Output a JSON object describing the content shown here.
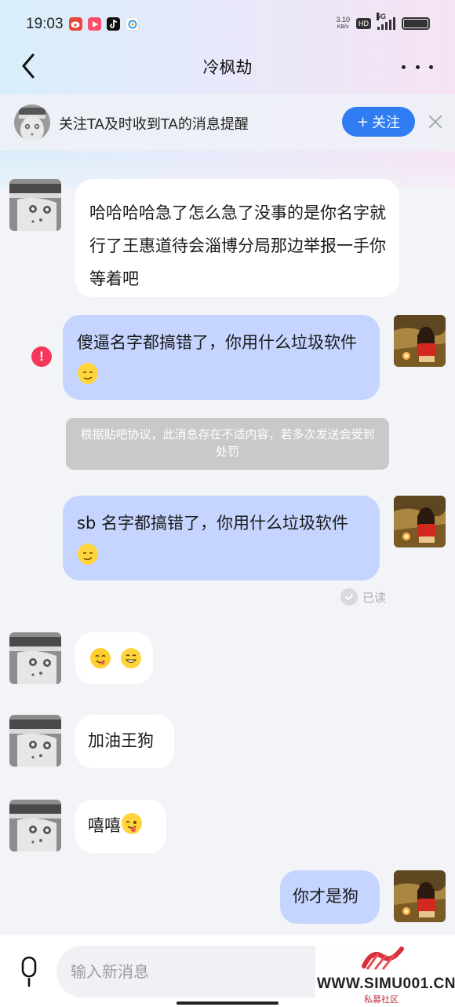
{
  "status_bar": {
    "time": "19:03",
    "net_speed_value": "3.10",
    "net_speed_unit": "KB/s",
    "hd_label": "HD",
    "signal_label": "5G"
  },
  "header": {
    "title": "冷枫劫",
    "back_icon": "chevron-left-icon",
    "more_icon": "more-dots-icon"
  },
  "follow_banner": {
    "text": "关注TA及时收到TA的消息提醒",
    "button_plus": "+",
    "button_label": "关注"
  },
  "messages": [
    {
      "side": "left",
      "text": "哈哈哈哈急了怎么急了没事的是你名字就行了王惠道待会淄博分局那边举报一手你等着吧"
    },
    {
      "side": "right",
      "text": "傻逼名字都搞错了，你用什么垃圾软件",
      "emoji": "smirk-emoji",
      "failed": true
    },
    {
      "side": "system",
      "text": "根据贴吧协议，此消息存在不适内容，若多次发送会受到处罚"
    },
    {
      "side": "right",
      "text": "sb 名字都搞错了，你用什么垃圾软件",
      "emoji": "smirk-emoji",
      "read": "已读"
    },
    {
      "side": "left",
      "text": "",
      "emojis": [
        "yum-emoji",
        "grin-emoji"
      ]
    },
    {
      "side": "left",
      "text": "加油王狗"
    },
    {
      "side": "left",
      "text": "嘻嘻",
      "emoji": "tongue-out-emoji"
    },
    {
      "side": "right",
      "text": "你才是狗"
    }
  ],
  "warning_mark": "!",
  "input": {
    "placeholder": "输入新消息"
  },
  "watermark": {
    "url": "WWW.SIMU001.CN",
    "sub": "私募社区"
  },
  "colors": {
    "accent": "#2f7cf3",
    "right_bubble": "#c6d5ff",
    "warning": "#f4375b"
  }
}
